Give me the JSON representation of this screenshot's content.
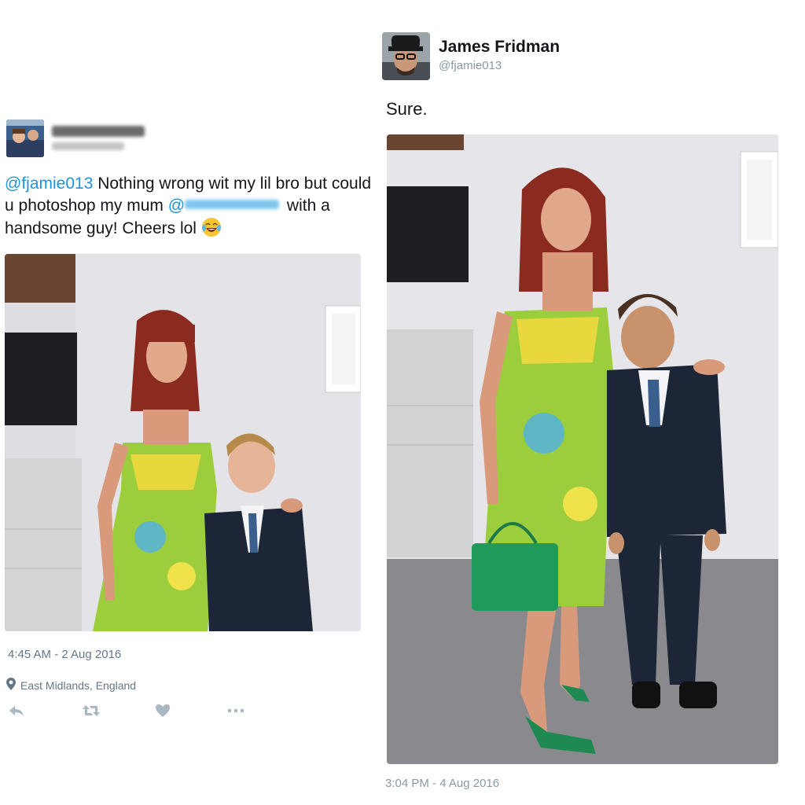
{
  "left_tweet": {
    "mention_handle": "@fjamie013",
    "text_part1": " Nothing wrong wit my lil bro but could u photoshop my mum ",
    "mention_prefix": "@",
    "text_part2": " with a handsome guy! Cheers lol",
    "emoji_icon": "tears-of-joy-emoji",
    "timestamp": "4:45 AM - 2 Aug 2016",
    "location": "East Midlands, England",
    "actions": [
      "reply-icon",
      "retweet-icon",
      "like-icon",
      "more-icon"
    ]
  },
  "right_tweet": {
    "display_name": "James Fridman",
    "handle": "@fjamie013",
    "text": "Sure.",
    "timestamp": "3:04 PM - 4 Aug 2016"
  },
  "colors": {
    "link": "#1b95e0",
    "secondary_text": "#657786",
    "muted_text": "#8899a6"
  }
}
